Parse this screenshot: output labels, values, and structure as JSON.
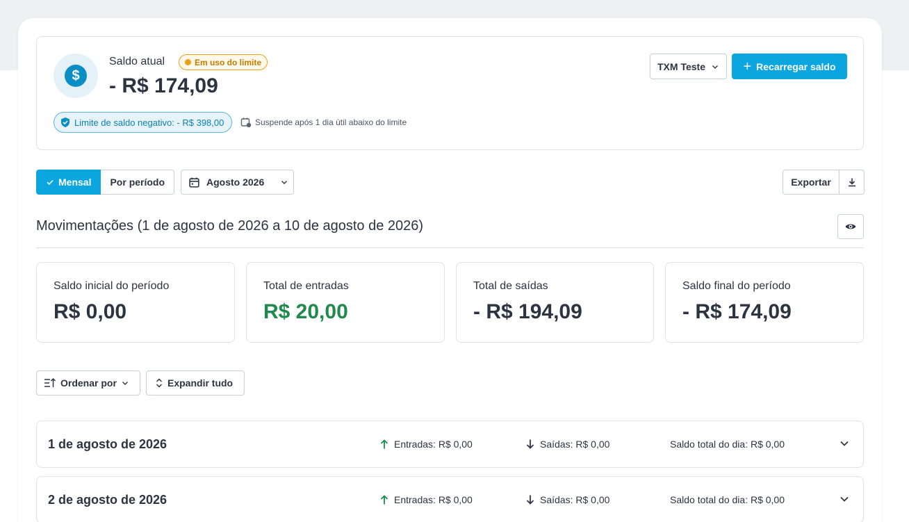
{
  "balance": {
    "label": "Saldo atual",
    "badge": "Em uso do limite",
    "value": "- R$ 174,09",
    "negative_limit": "Limite de saldo negativo: - R$ 398,00",
    "suspend_note": "Suspende após 1 dia útil abaixo do limite",
    "account": "TXM Teste",
    "recharge_label": "Recarregar saldo"
  },
  "filters": {
    "monthly_label": "Mensal",
    "period_label": "Por período",
    "month": "Agosto 2026",
    "export_label": "Exportar"
  },
  "section": {
    "title": "Movimentações (1 de agosto de 2026 a 10 de agosto de 2026)"
  },
  "stats": [
    {
      "label": "Saldo inicial do período",
      "value": "R$ 0,00"
    },
    {
      "label": "Total de entradas",
      "value": "R$ 20,00"
    },
    {
      "label": "Total de saídas",
      "value": "- R$ 194,09"
    },
    {
      "label": "Saldo final do período",
      "value": "- R$ 174,09"
    }
  ],
  "toolbar": {
    "sort_label": "Ordenar por",
    "expand_label": "Expandir tudo"
  },
  "days": [
    {
      "date": "1 de agosto de 2026",
      "in": "Entradas: R$ 0,00",
      "out": "Saídas: R$ 0,00",
      "total": "Saldo total do dia: R$ 0,00"
    },
    {
      "date": "2 de agosto de 2026",
      "in": "Entradas: R$ 0,00",
      "out": "Saídas: R$ 0,00",
      "total": "Saldo total do dia: R$ 0,00"
    }
  ],
  "colors": {
    "primary": "#0ba5e0",
    "warning": "#e8a21a",
    "positive": "#1f8a4c",
    "text": "#2b3440"
  }
}
